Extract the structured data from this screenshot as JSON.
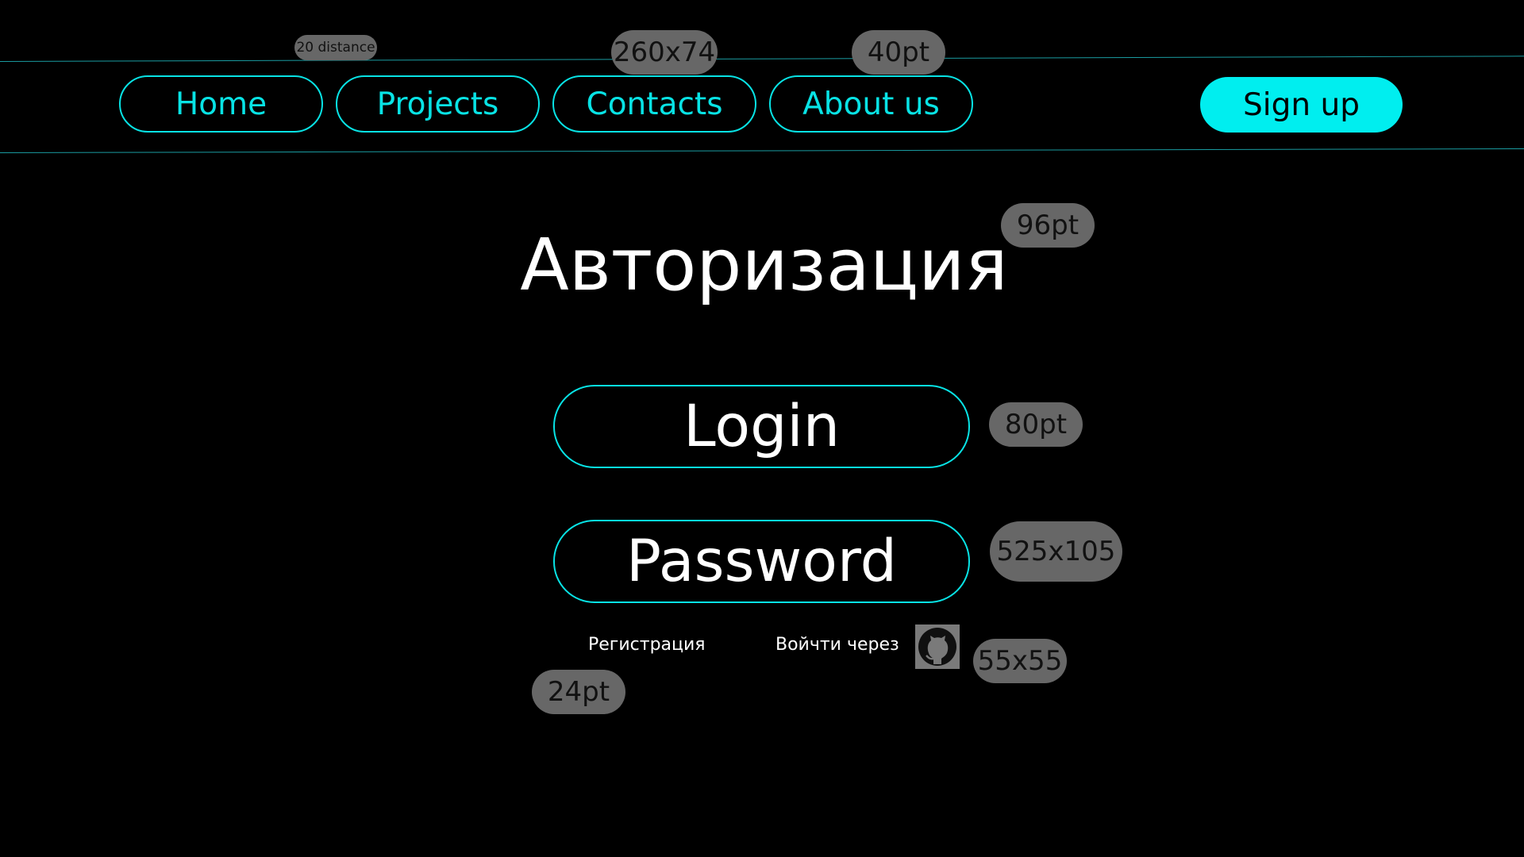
{
  "nav": {
    "home_label": "Home",
    "projects_label": "Projects",
    "contacts_label": "Contacts",
    "about_label": "About us",
    "signup_label": "Sign up"
  },
  "main": {
    "title": "Авторизация",
    "login_field": "Login",
    "password_field": "Password",
    "register_link": "Регистрация",
    "login_via_text": "Войчти через",
    "github_icon": "github-icon"
  },
  "annotations": {
    "distance": "20 distance",
    "nav_button_size": "260x74",
    "nav_font_size": "40pt",
    "title_font_size": "96pt",
    "field_font_size": "80pt",
    "field_size": "525x105",
    "icon_size": "55x55",
    "small_font_size": "24pt"
  },
  "colors": {
    "accent": "#08e3e5",
    "signup_fill": "#00eeef",
    "background": "#000000",
    "annotation_badge": "#676767"
  }
}
